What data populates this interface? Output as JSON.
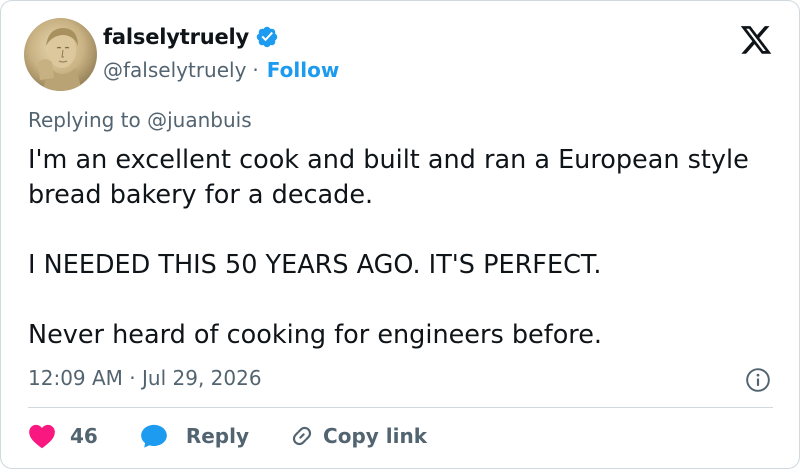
{
  "user": {
    "display_name": "falselytruely",
    "handle": "@falselytruely",
    "separator": "·",
    "follow_label": "Follow"
  },
  "reply_context": "Replying to @juanbuis",
  "tweet": {
    "paragraphs": [
      "I'm an excellent cook and built and ran a European style bread bakery for a decade.",
      "I NEEDED THIS 50 YEARS AGO. IT'S PERFECT.",
      "Never heard of cooking for engineers before."
    ],
    "timestamp": "12:09 AM · Jul 29, 2026"
  },
  "actions": {
    "like_count": "46",
    "reply_label": "Reply",
    "copy_label": "Copy link"
  },
  "colors": {
    "accent": "#1d9bf0",
    "like": "#f91880",
    "muted": "#536471",
    "text": "#0f1419"
  },
  "icons": {
    "verified": "verified-badge-icon",
    "brand": "x-logo-icon",
    "info": "info-icon",
    "like": "heart-icon",
    "reply": "speech-bubble-icon",
    "copy": "link-icon"
  }
}
